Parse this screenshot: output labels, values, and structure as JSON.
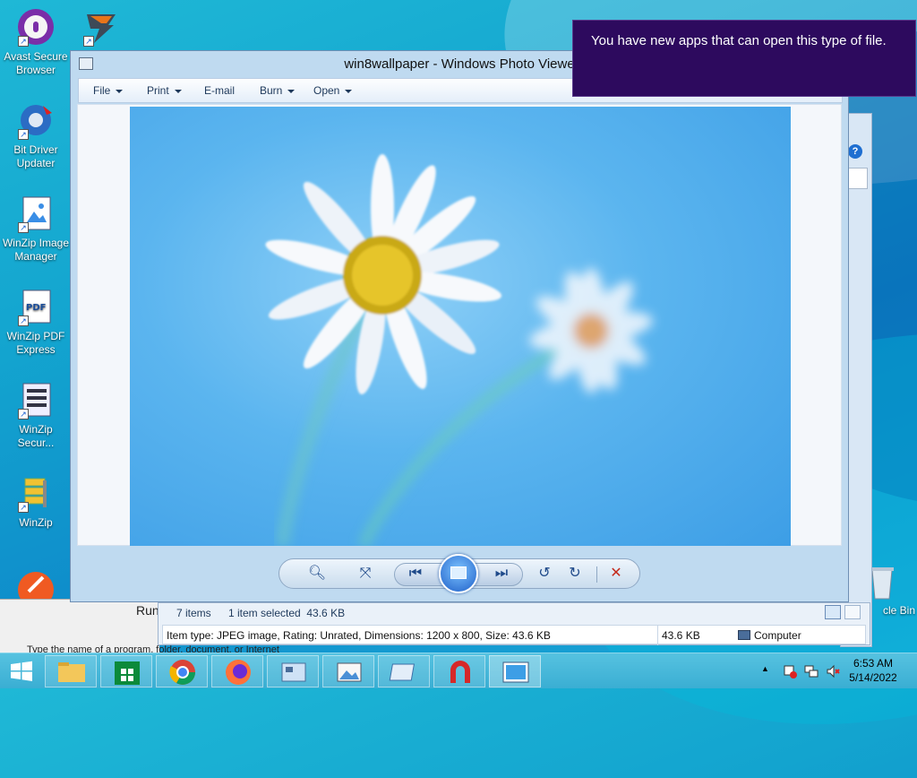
{
  "desktop": {
    "icons": [
      {
        "label": "Avast Secure Browser",
        "icon": "avast-browser-icon"
      },
      {
        "label": "Bit Driver Updater",
        "icon": "bit-driver-updater-icon"
      },
      {
        "label": "WinZip Image Manager",
        "icon": "winzip-image-manager-icon"
      },
      {
        "label": "WinZip PDF Express",
        "icon": "winzip-pdf-express-icon"
      },
      {
        "label": "WinZip Secur...",
        "icon": "winzip-secure-icon"
      },
      {
        "label": "WinZip",
        "icon": "winzip-icon"
      }
    ],
    "recycle_bin_label": "cle Bin"
  },
  "photo_viewer": {
    "title": "win8wallpaper - Windows Photo Viewe",
    "menu": {
      "file": "File",
      "print": "Print",
      "email": "E-mail",
      "burn": "Burn",
      "open": "Open"
    }
  },
  "explorer": {
    "item_count": "7 items",
    "selection": "1 item selected  43.6 KB",
    "details": "Item type: JPEG image, Rating: Unrated, Dimensions: 1200 x 800, Size: 43.6 KB",
    "size": "43.6 KB",
    "location": "Computer"
  },
  "run_dialog": {
    "label": "Run",
    "prompt": "Type the name of a program, folder, document, or Internet"
  },
  "notification": {
    "message": "You have new apps that can open this type of file."
  },
  "taskbar": {
    "clock_time": "6:53 AM",
    "clock_date": "5/14/2022"
  },
  "colors": {
    "toast_bg": "#2d0a5e",
    "taskbar": "#3aaed3",
    "close_red": "#c42b1c"
  }
}
